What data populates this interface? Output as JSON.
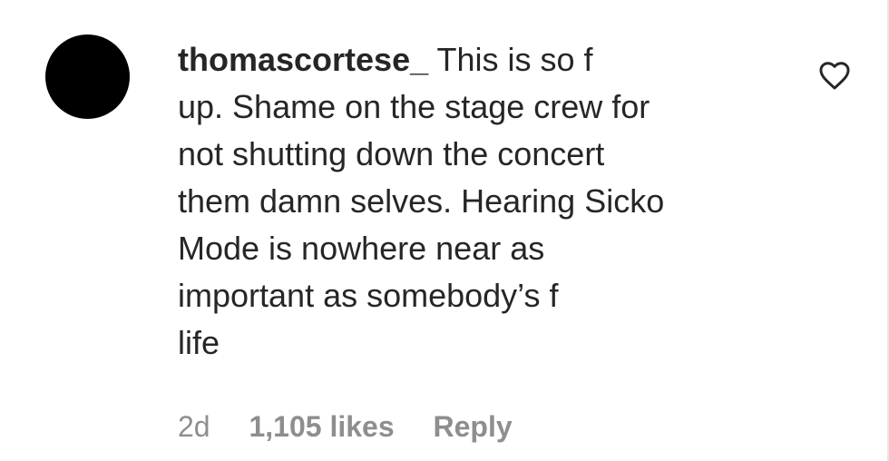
{
  "comment": {
    "username": "thomascortese_",
    "lines": [
      "This is so ",
      "up. Shame on the stage crew for",
      "not shutting down the concert",
      "them damn selves. Hearing Sicko",
      "Mode is nowhere near as",
      "important as somebody’s ",
      "life"
    ],
    "clipped_glyph_1": "f",
    "clipped_glyph_2": "f"
  },
  "meta": {
    "time": "2d",
    "likes": "1,105 likes",
    "reply_label": "Reply"
  },
  "icons": {
    "like": "heart-outline-icon"
  },
  "colors": {
    "text": "#262626",
    "meta": "#8e8e8e",
    "avatar": "#000000"
  }
}
